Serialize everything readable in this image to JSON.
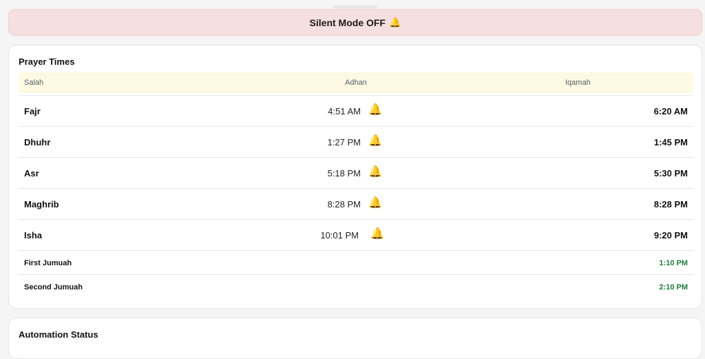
{
  "banner": {
    "text": "Silent Mode OFF",
    "icon": "🔔"
  },
  "prayer_card": {
    "title": "Prayer Times",
    "headers": {
      "salah": "Salah",
      "adhan": "Adhan",
      "iqamah": "Iqamah"
    },
    "rows": [
      {
        "name": "Fajr",
        "adhan": "4:51 AM",
        "iqamah": "6:20 AM",
        "bell": "🔔"
      },
      {
        "name": "Dhuhr",
        "adhan": "1:27 PM",
        "iqamah": "1:45 PM",
        "bell": "🔔"
      },
      {
        "name": "Asr",
        "adhan": "5:18 PM",
        "iqamah": "5:30 PM",
        "bell": "🔔"
      },
      {
        "name": "Maghrib",
        "adhan": "8:28 PM",
        "iqamah": "8:28 PM",
        "bell": "🔔"
      },
      {
        "name": "Isha",
        "adhan": "10:01 PM",
        "iqamah": "9:20 PM",
        "bell": "🔔"
      }
    ],
    "jumuah": [
      {
        "name": "First Jumuah",
        "time": "1:10 PM"
      },
      {
        "name": "Second Jumuah",
        "time": "2:10 PM"
      }
    ]
  },
  "automation_card": {
    "title": "Automation Status"
  },
  "colors": {
    "banner_bg": "#f6dfe0",
    "header_bg": "#fdf9e3",
    "jumuah_time": "#1f7a3a"
  }
}
